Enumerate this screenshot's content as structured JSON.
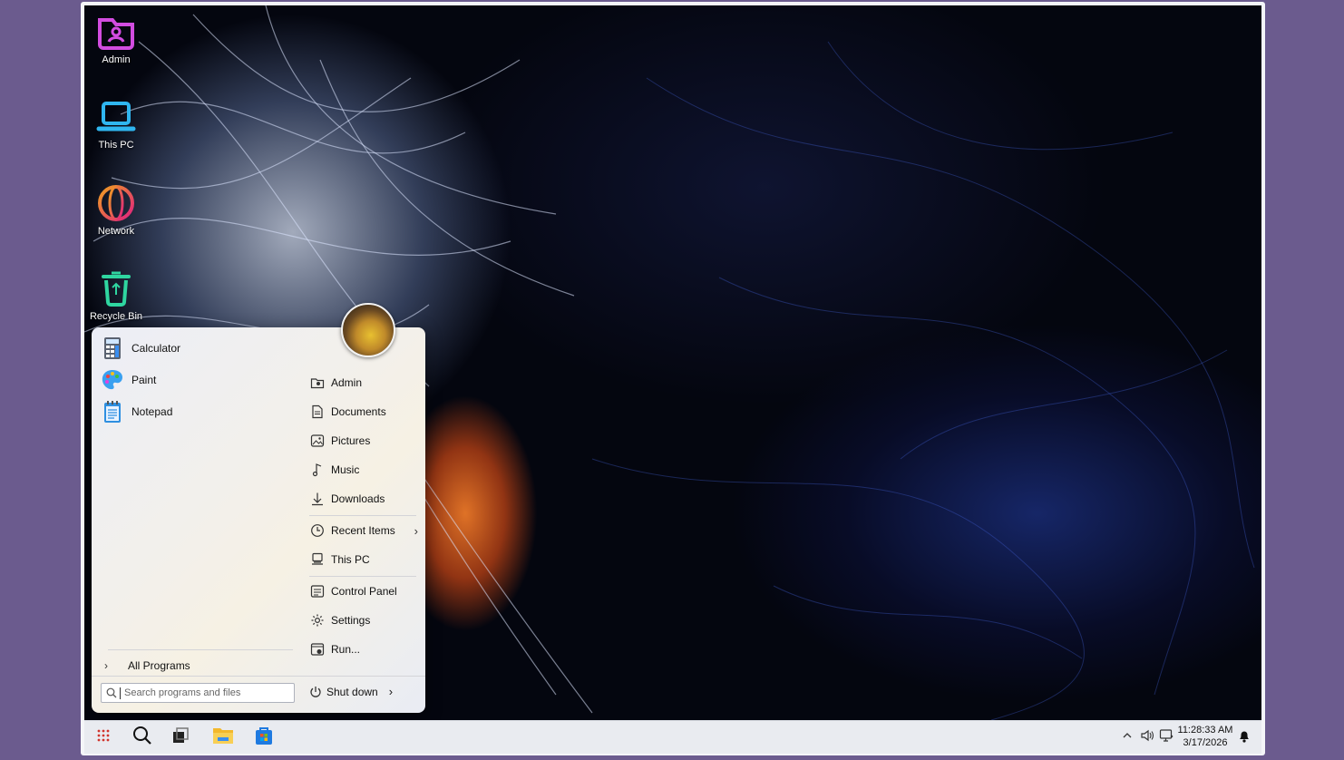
{
  "desktop": {
    "icons": [
      {
        "label": "Admin"
      },
      {
        "label": "This PC"
      },
      {
        "label": "Network"
      },
      {
        "label": "Recycle Bin"
      }
    ]
  },
  "start_menu": {
    "apps": [
      {
        "label": "Calculator"
      },
      {
        "label": "Paint"
      },
      {
        "label": "Notepad"
      }
    ],
    "places": [
      {
        "label": "Admin"
      },
      {
        "label": "Documents"
      },
      {
        "label": "Pictures"
      },
      {
        "label": "Music"
      },
      {
        "label": "Downloads"
      },
      {
        "label": "Recent Items"
      },
      {
        "label": "This PC"
      },
      {
        "label": "Control Panel"
      },
      {
        "label": "Settings"
      },
      {
        "label": "Run..."
      }
    ],
    "all_programs": "All Programs",
    "search_placeholder": "Search programs and files",
    "shutdown_label": "Shut down"
  },
  "taskbar": {
    "time": "11:28:33 AM",
    "date": "3/17/2026"
  },
  "colors": {
    "frame": "#6b5b8e",
    "taskbar": "#e9ebf0"
  }
}
